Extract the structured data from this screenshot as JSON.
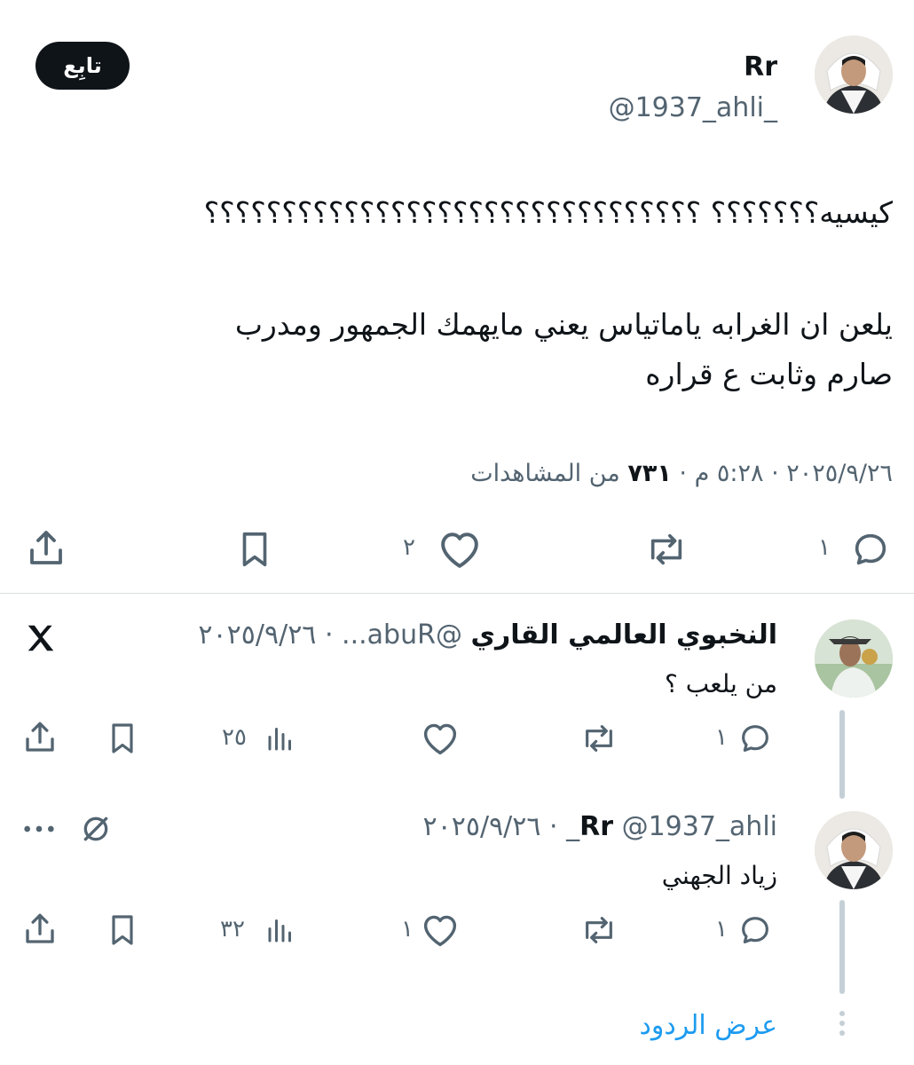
{
  "main_tweet": {
    "display_name": "Rr",
    "handle": "@1937_ahli_",
    "follow_label": "تابِع",
    "text_line1": "كيسيه؟؟؟؟؟؟؟ ؟؟؟؟؟؟؟؟؟؟؟؟؟؟؟؟؟؟؟؟؟؟؟؟؟؟؟؟؟؟؟؟",
    "text_line2": "يلعن ان الغرابه ياماتياس يعني مايهمك الجمهور ومدرب",
    "text_line3": "صارم وثابت ع قراره",
    "date": "٢٠٢٥/٩/٢٦",
    "time": "٥:٢٨ م",
    "views_count": "٧٣١",
    "views_label": "من المشاهدات",
    "replies": "١",
    "retweets": "",
    "likes": "٢"
  },
  "reply1": {
    "display_name": "النخبوي العالمي القاري",
    "handle": "@abuR...",
    "date": "٢٠٢٥/٩/٢٦",
    "text": "من يلعب ؟",
    "replies": "١",
    "retweets": "",
    "likes": "",
    "views": "٢٥"
  },
  "reply2": {
    "display_name": "Rr",
    "handle": "@1937_ahli_",
    "date": "٢٠٢٥/٩/٢٦",
    "text": "زياد الجهني",
    "replies": "١",
    "retweets": "",
    "likes": "١",
    "views": "٣٢"
  },
  "show_replies_label": "عرض الردود",
  "colors": {
    "accent": "#1d9bf0",
    "text": "#0f1419",
    "secondary": "#536471"
  }
}
